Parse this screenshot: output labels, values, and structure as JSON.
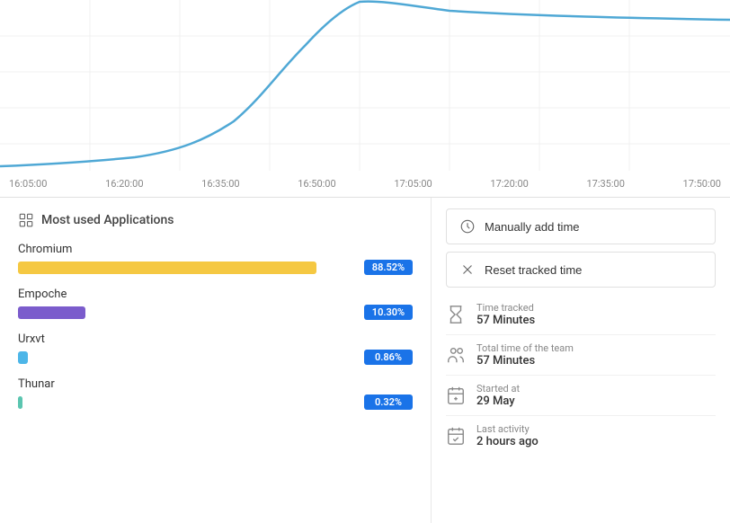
{
  "chart": {
    "timeLabels": [
      "16:05:00",
      "16:20:00",
      "16:35:00",
      "16:50:00",
      "17:05:00",
      "17:20:00",
      "17:35:00",
      "17:50:00"
    ]
  },
  "mostUsedApps": {
    "header": "Most used Applications",
    "apps": [
      {
        "name": "Chromium",
        "barWidth": "88%",
        "barColor": "bar-yellow",
        "badge": "88.52%"
      },
      {
        "name": "Empoche",
        "barWidth": "20%",
        "barColor": "bar-purple",
        "badge": "10.30%"
      },
      {
        "name": "Urxvt",
        "barWidth": "3%",
        "barColor": "bar-blue-light",
        "badge": "0.86%"
      },
      {
        "name": "Thunar",
        "barWidth": "1.2%",
        "barColor": "bar-teal",
        "badge": "0.32%"
      }
    ]
  },
  "actions": [
    {
      "id": "manually-add",
      "label": "Manually add time"
    },
    {
      "id": "reset-tracked",
      "label": "Reset tracked time"
    }
  ],
  "stats": [
    {
      "id": "time-tracked",
      "label": "Time tracked",
      "value": "57 Minutes"
    },
    {
      "id": "total-time-team",
      "label": "Total time of the team",
      "value": "57 Minutes"
    },
    {
      "id": "started-at",
      "label": "Started at",
      "value": "29 May"
    },
    {
      "id": "last-activity",
      "label": "Last activity",
      "value": "2 hours ago"
    }
  ]
}
